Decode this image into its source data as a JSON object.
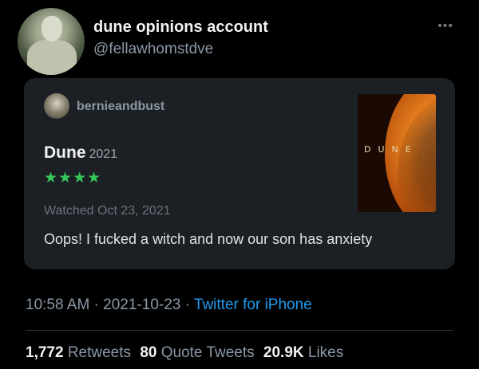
{
  "tweet": {
    "display_name": "dune opinions account",
    "handle": "@fellawhomstdve",
    "more_icon": "ellipsis-icon",
    "timestamp": "10:58 AM · 2021-10-23 · ",
    "source": "Twitter for iPhone"
  },
  "card": {
    "username": "bernieandbust",
    "film_title": "Dune",
    "film_year": "2021",
    "stars": "★★★★",
    "rating_stars": 4,
    "watched": "Watched Oct 23, 2021",
    "review": "Oops! I fucked a witch and now our son has anxiety",
    "poster_logo": "DUNE"
  },
  "stats": {
    "retweets_count": "1,772",
    "retweets_label": "Retweets",
    "quotes_count": "80",
    "quotes_label": "Quote Tweets",
    "likes_count": "20.9K",
    "likes_label": "Likes"
  },
  "colors": {
    "background": "#000000",
    "card": "#1c1f23",
    "stars": "#36c55a",
    "link": "#1d9bf0",
    "muted": "#8b98a5"
  }
}
